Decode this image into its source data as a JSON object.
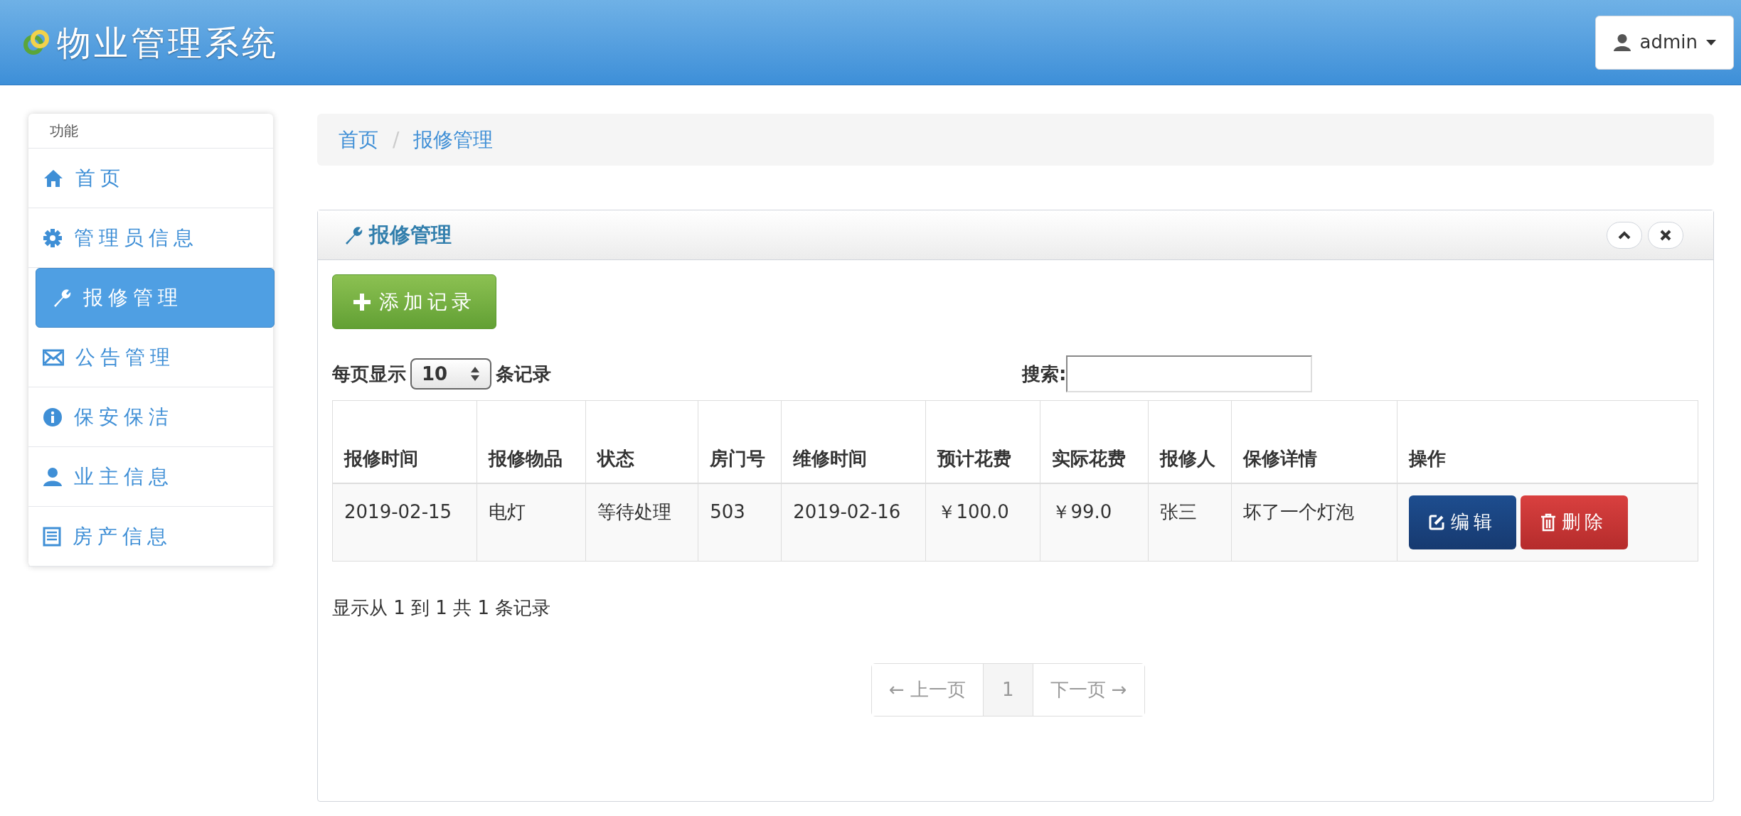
{
  "header": {
    "title": "物业管理系统",
    "user": "admin"
  },
  "sidebar": {
    "heading": "功能",
    "items": [
      {
        "label": "首页",
        "kind": "home",
        "selected": false
      },
      {
        "label": "管理员信息",
        "kind": "gear",
        "selected": false
      },
      {
        "label": "报修管理",
        "kind": "wrench",
        "selected": true
      },
      {
        "label": "公告管理",
        "kind": "mail",
        "selected": false
      },
      {
        "label": "保安保洁",
        "kind": "info",
        "selected": false
      },
      {
        "label": "业主信息",
        "kind": "user",
        "selected": false
      },
      {
        "label": "房产信息",
        "kind": "list",
        "selected": false
      }
    ]
  },
  "breadcrumb": [
    "首页",
    "报修管理"
  ],
  "breadcrumb_separator": "/",
  "panel": {
    "title": "报修管理",
    "add_button": "添加记录",
    "length_prefix": "每页显示",
    "length_value": "10",
    "length_suffix": "条记录",
    "search_label": "搜索:",
    "table": {
      "columns": [
        "报修时间",
        "报修物品",
        "状态",
        "房门号",
        "维修时间",
        "预计花费",
        "实际花费",
        "报修人",
        "保修详情",
        "操作"
      ],
      "rows": [
        {
          "cells": [
            "2019-02-15",
            "电灯",
            "等待处理",
            "503",
            "2019-02-16",
            "￥100.0",
            "￥99.0",
            "张三",
            "坏了一个灯泡"
          ],
          "actions": [
            "编辑",
            "删除"
          ]
        }
      ]
    },
    "info": "显示从 1 到 1 共 1 条记录",
    "pagination": [
      {
        "label": "← 上一页",
        "selected": false
      },
      {
        "label": "1",
        "selected": true
      },
      {
        "label": "下一页 →",
        "selected": false
      }
    ]
  }
}
